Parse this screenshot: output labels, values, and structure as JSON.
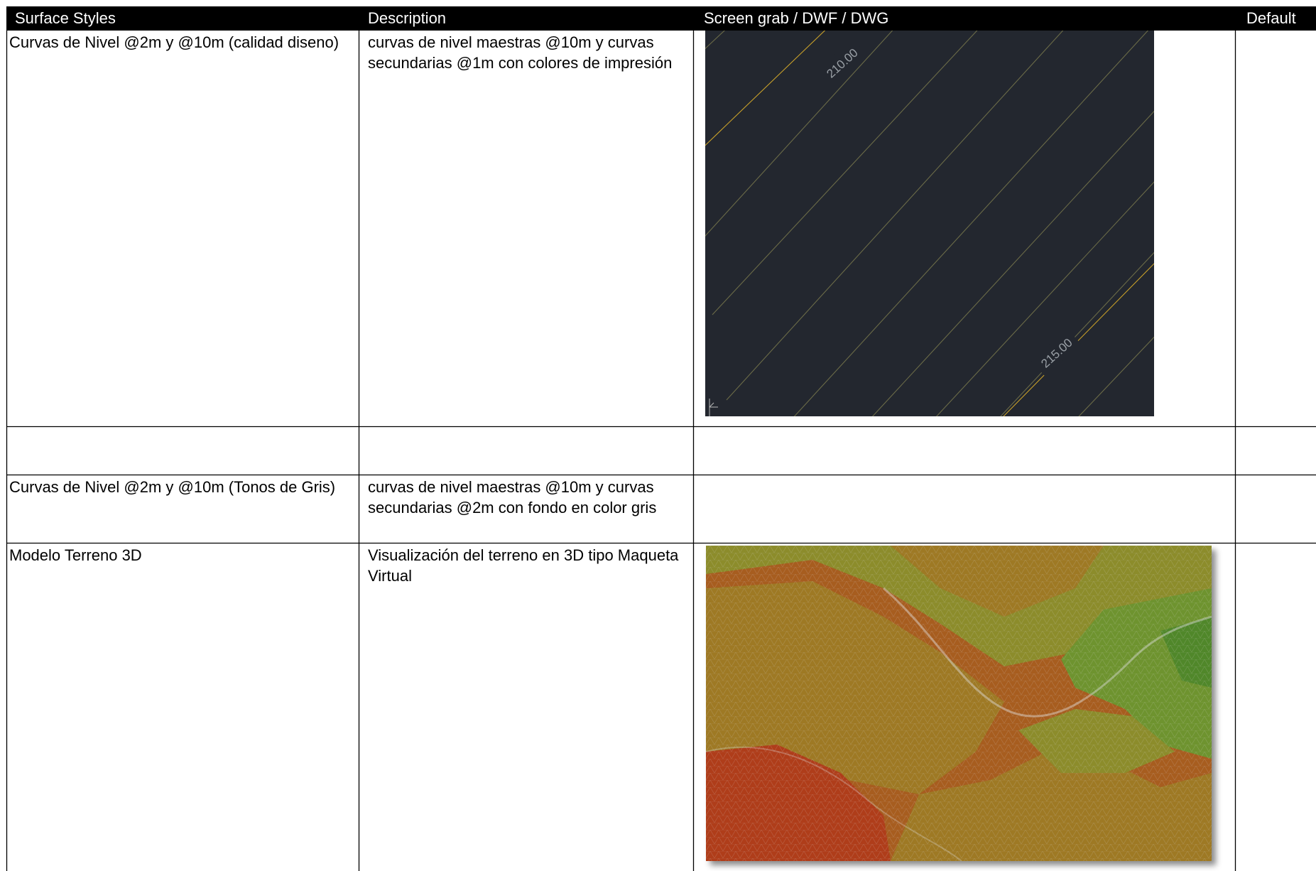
{
  "headers": {
    "col1": "Surface Styles",
    "col2": "Description",
    "col3": "Screen grab / DWF / DWG",
    "col4": "Default"
  },
  "rows": [
    {
      "name": "Curvas de Nivel @2m y @10m (calidad diseno)",
      "description": "curvas de nivel maestras @10m y curvas secundarias @1m con colores de impresión",
      "image": {
        "background": "#23272f",
        "line_color": "#6b6b48",
        "major_line_color": "#c8a02a",
        "labels": [
          "210.00",
          "215.00"
        ]
      }
    },
    {
      "name": "",
      "description": ""
    },
    {
      "name": "Curvas de Nivel @2m y @10m (Tonos de Gris)",
      "description": "curvas de nivel maestras @10m y curvas secundarias @2m con fondo en color gris"
    },
    {
      "name": "Modelo Terreno 3D",
      "description": "Visualización del terreno en 3D tipo Maqueta Virtual",
      "image": {
        "colors": [
          "#c8461e",
          "#bf6a24",
          "#b48a2a",
          "#a0a032",
          "#7ea836",
          "#5c9a30"
        ]
      }
    }
  ]
}
